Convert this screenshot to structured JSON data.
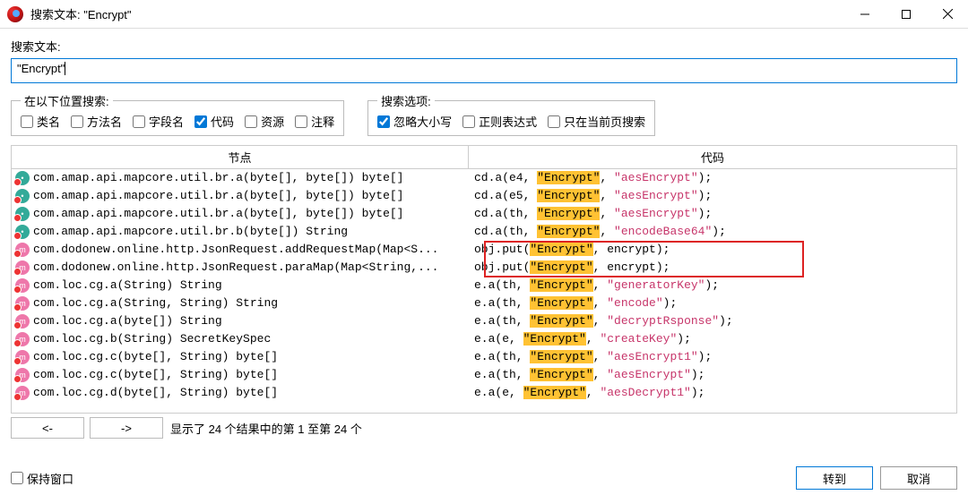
{
  "title": "搜索文本: \"Encrypt\"",
  "label_search": "搜索文本:",
  "search_value": "\"Encrypt\"",
  "group_where": "在以下位置搜索:",
  "group_opts": "搜索选项:",
  "chk": {
    "classname": "类名",
    "methodname": "方法名",
    "fieldname": "字段名",
    "code": "代码",
    "resource": "资源",
    "comment": "注释",
    "ignorecase": "忽略大小写",
    "regex": "正则表达式",
    "currentpage": "只在当前页搜索"
  },
  "col_node": "节点",
  "col_code": "代码",
  "nav_prev": "<-",
  "nav_next": "->",
  "status": "显示了 24 个结果中的第 1 至第 24 个",
  "keep_window": "保持窗口",
  "btn_goto": "转到",
  "btn_cancel": "取消",
  "rows": [
    {
      "ic": "blue",
      "node": "com.amap.api.mapcore.util.br.a(byte[], byte[]) byte[]",
      "c": [
        "cd.a(e4, ",
        [
          "hl",
          "\"Encrypt\""
        ],
        ", ",
        [
          "str",
          "\"aesEncrypt\""
        ],
        ");"
      ]
    },
    {
      "ic": "blue",
      "node": "com.amap.api.mapcore.util.br.a(byte[], byte[]) byte[]",
      "c": [
        "cd.a(e5, ",
        [
          "hl",
          "\"Encrypt\""
        ],
        ", ",
        [
          "str",
          "\"aesEncrypt\""
        ],
        ");"
      ]
    },
    {
      "ic": "blue",
      "node": "com.amap.api.mapcore.util.br.a(byte[], byte[]) byte[]",
      "c": [
        "cd.a(th, ",
        [
          "hl",
          "\"Encrypt\""
        ],
        ", ",
        [
          "str",
          "\"aesEncrypt\""
        ],
        ");"
      ]
    },
    {
      "ic": "blue",
      "node": "com.amap.api.mapcore.util.br.b(byte[]) String",
      "c": [
        "cd.a(th, ",
        [
          "hl",
          "\"Encrypt\""
        ],
        ", ",
        [
          "str",
          "\"encodeBase64\""
        ],
        ");"
      ]
    },
    {
      "ic": "pink",
      "node": "com.dodonew.online.http.JsonRequest.addRequestMap(Map<S...",
      "c": [
        "obj.put(",
        [
          "hl",
          "\"Encrypt\""
        ],
        ", encrypt);"
      ]
    },
    {
      "ic": "pink",
      "node": "com.dodonew.online.http.JsonRequest.paraMap(Map<String,...",
      "c": [
        "obj.put(",
        [
          "hl",
          "\"Encrypt\""
        ],
        ", encrypt);"
      ]
    },
    {
      "ic": "pink",
      "node": "com.loc.cg.a(String) String",
      "c": [
        "e.a(th, ",
        [
          "hl",
          "\"Encrypt\""
        ],
        ", ",
        [
          "str",
          "\"generatorKey\""
        ],
        ");"
      ]
    },
    {
      "ic": "pink",
      "node": "com.loc.cg.a(String, String) String",
      "c": [
        "e.a(th, ",
        [
          "hl",
          "\"Encrypt\""
        ],
        ", ",
        [
          "str",
          "\"encode\""
        ],
        ");"
      ]
    },
    {
      "ic": "pink",
      "node": "com.loc.cg.a(byte[]) String",
      "c": [
        "e.a(th, ",
        [
          "hl",
          "\"Encrypt\""
        ],
        ", ",
        [
          "str",
          "\"decryptRsponse\""
        ],
        ");"
      ]
    },
    {
      "ic": "pink",
      "node": "com.loc.cg.b(String) SecretKeySpec",
      "c": [
        "e.a(e, ",
        [
          "hl",
          "\"Encrypt\""
        ],
        ", ",
        [
          "str",
          "\"createKey\""
        ],
        ");"
      ]
    },
    {
      "ic": "pink",
      "node": "com.loc.cg.c(byte[], String) byte[]",
      "c": [
        "e.a(th, ",
        [
          "hl",
          "\"Encrypt\""
        ],
        ", ",
        [
          "str",
          "\"aesEncrypt1\""
        ],
        ");"
      ]
    },
    {
      "ic": "pink",
      "node": "com.loc.cg.c(byte[], String) byte[]",
      "c": [
        "e.a(th, ",
        [
          "hl",
          "\"Encrypt\""
        ],
        ", ",
        [
          "str",
          "\"aesEncrypt\""
        ],
        ");"
      ]
    },
    {
      "ic": "pink",
      "node": "com.loc.cg.d(byte[], String) byte[]",
      "c": [
        "e.a(e, ",
        [
          "hl",
          "\"Encrypt\""
        ],
        ", ",
        [
          "str",
          "\"aesDecrypt1\""
        ],
        ");"
      ]
    }
  ]
}
